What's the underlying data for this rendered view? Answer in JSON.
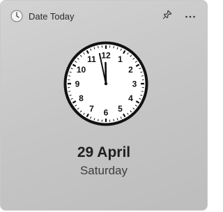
{
  "app": {
    "title": "Date Today",
    "icon": "clock-icon",
    "pin_icon": "pin-icon",
    "more_icon": "more-options-icon"
  },
  "clock": {
    "numerals": [
      "12",
      "1",
      "2",
      "3",
      "4",
      "5",
      "6",
      "7",
      "8",
      "9",
      "10",
      "11"
    ],
    "time": {
      "hour": 11,
      "minute": 58
    },
    "face_color": "#ffffff",
    "rim_color": "#111111"
  },
  "date": {
    "date_label": "29 April",
    "weekday": "Saturday"
  }
}
